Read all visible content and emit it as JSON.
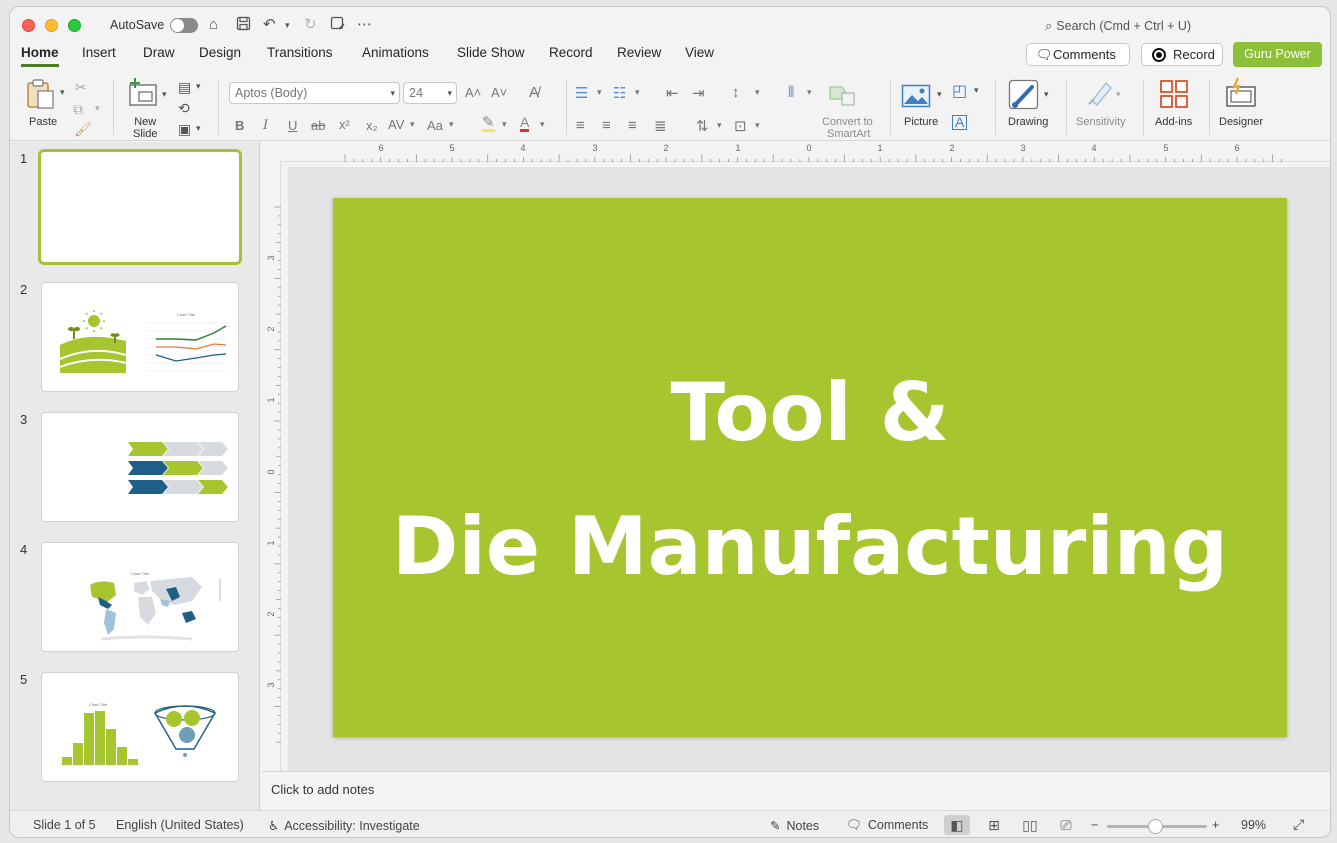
{
  "titlebar": {
    "autosave_label": "AutoSave",
    "search_placeholder": "Search (Cmd + Ctrl + U)"
  },
  "tabs": [
    "Home",
    "Insert",
    "Draw",
    "Design",
    "Transitions",
    "Animations",
    "Slide Show",
    "Record",
    "Review",
    "View"
  ],
  "active_tab": "Home",
  "header_buttons": {
    "comments": "Comments",
    "record": "Record",
    "guru": "Guru Power",
    "guru_color": "#8dbf38"
  },
  "ribbon": {
    "paste": "Paste",
    "new_slide": "New\nSlide",
    "font_name": "Aptos (Body)",
    "font_size": "24",
    "convert_smartart_1": "Convert to",
    "convert_smartart_2": "SmartArt",
    "picture": "Picture",
    "drawing": "Drawing",
    "sensitivity": "Sensitivity",
    "addins": "Add-ins",
    "designer": "Designer",
    "format": {
      "bold": "B",
      "italic": "I",
      "underline": "U",
      "strike": "ab",
      "superscript": "x²",
      "subscript": "x₂",
      "spacing": "AV",
      "case": "Aa"
    }
  },
  "slides": [
    {
      "number": "1"
    },
    {
      "number": "2"
    },
    {
      "number": "3"
    },
    {
      "number": "4"
    },
    {
      "number": "5"
    }
  ],
  "slide_mini_titles": {
    "slide2": "Chart Title",
    "slide4": "Chart Title",
    "slide5": "Chart Title"
  },
  "current_slide": {
    "line1": "Tool &",
    "line2": "Die Manufacturing",
    "background": "#a7c52e"
  },
  "notes_placeholder": "Click to add notes",
  "ruler": {
    "h_labels": [
      "6",
      "5",
      "4",
      "3",
      "2",
      "1",
      "0",
      "1",
      "2",
      "3",
      "4",
      "5",
      "6"
    ],
    "v_labels": [
      "3",
      "2",
      "1",
      "0",
      "1",
      "2",
      "3"
    ]
  },
  "status": {
    "slide_info": "Slide 1 of 5",
    "language": "English (United States)",
    "accessibility": "Accessibility: Investigate",
    "notes": "Notes",
    "comments": "Comments",
    "zoom_minus": "−",
    "zoom_plus": "+",
    "zoom": "99%"
  }
}
